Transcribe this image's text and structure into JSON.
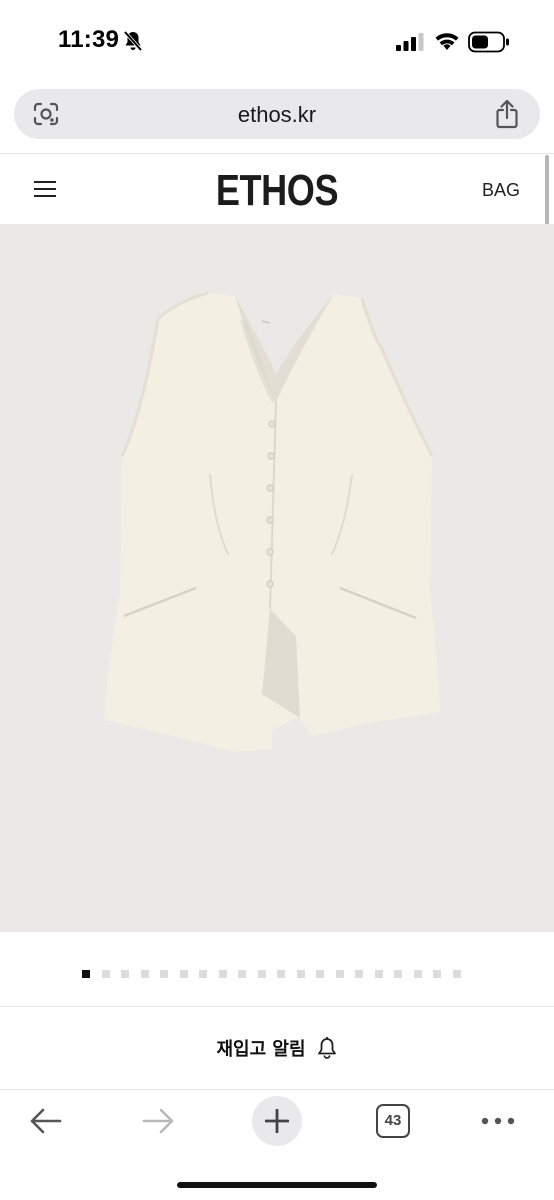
{
  "status_bar": {
    "time": "11:39",
    "icons": [
      "silent-mode-icon",
      "signal-icon",
      "wifi-icon",
      "battery-icon"
    ]
  },
  "address_bar": {
    "url": "ethos.kr",
    "icons": [
      "lens-icon",
      "share-icon"
    ]
  },
  "site_header": {
    "brand": "ETHOS",
    "bag_label": "BAG",
    "menu_icon": "hamburger-menu-icon"
  },
  "product": {
    "image": "cream-vest-image",
    "image_background": "#ebe9e8",
    "garment_color": "#f3efe3"
  },
  "carousel": {
    "total": 20,
    "active_index": 0
  },
  "restock": {
    "label": "재입고 알림",
    "icon": "bell-icon"
  },
  "toolbar": {
    "tab_count": "43",
    "icons": [
      "back-arrow-icon",
      "forward-arrow-icon",
      "plus-icon",
      "tabs-icon",
      "more-icon"
    ]
  }
}
